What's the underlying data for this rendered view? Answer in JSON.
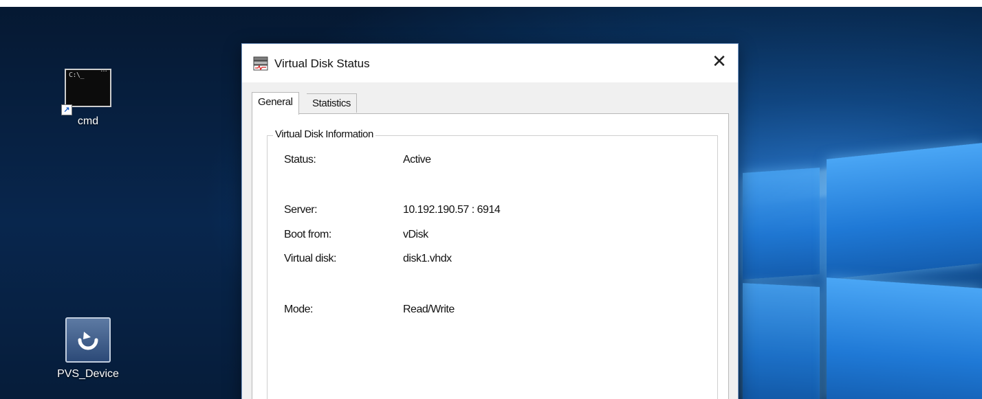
{
  "desktop": {
    "icons": [
      {
        "label": "cmd",
        "icon": "cmd-icon",
        "prompt": "C:\\_"
      },
      {
        "label": "PVS_Device",
        "icon": "pvs-device-icon"
      }
    ]
  },
  "dialog": {
    "title": "Virtual Disk Status",
    "close_label": "✕",
    "tabs": [
      {
        "label": "General",
        "active": true
      },
      {
        "label": "Statistics",
        "active": false
      }
    ],
    "group_title": "Virtual Disk Information",
    "fields": {
      "status": {
        "label": "Status:",
        "value": "Active"
      },
      "server": {
        "label": "Server:",
        "value": "10.192.190.57 : 6914"
      },
      "boot": {
        "label": "Boot from:",
        "value": "vDisk"
      },
      "vdisk": {
        "label": "Virtual disk:",
        "value": "disk1.vhdx"
      },
      "mode": {
        "label": "Mode:",
        "value": "Read/Write"
      }
    }
  },
  "colors": {
    "desktop_blue": "#0b3d76",
    "dialog_border": "#7a9cc8",
    "panel_gray": "#f0f0f0"
  }
}
